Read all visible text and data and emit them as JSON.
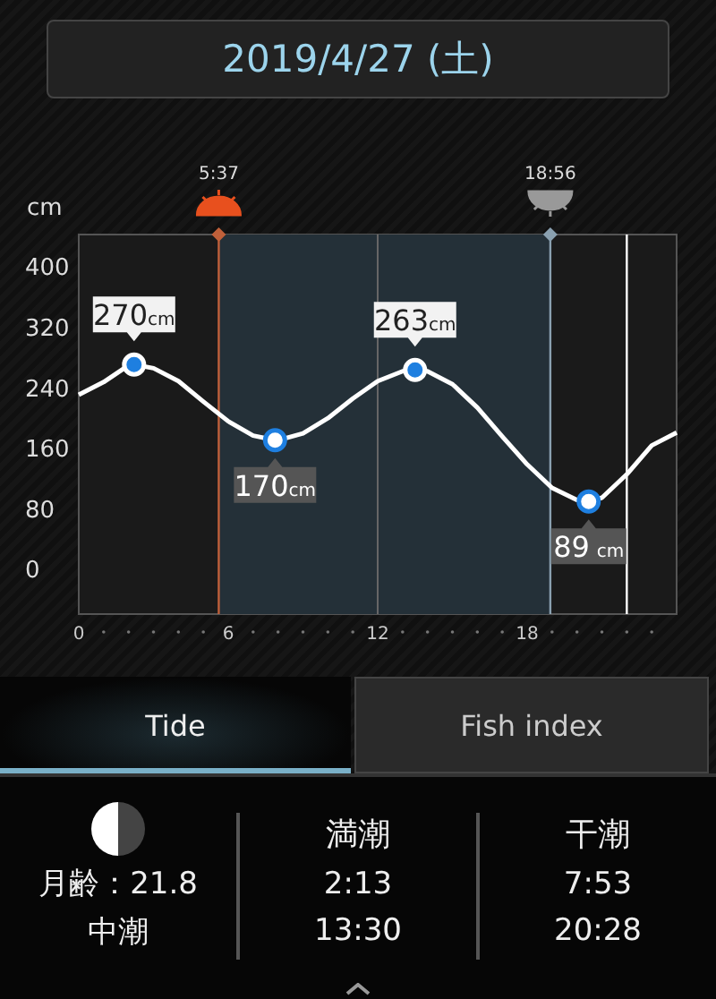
{
  "header": {
    "date": "2019/4/27 (土)"
  },
  "chart": {
    "chart_data": {
      "type": "line",
      "ylabel": "cm",
      "x": [
        0,
        1,
        2,
        2.22,
        3,
        4,
        5,
        6,
        7,
        7.88,
        8,
        9,
        10,
        11,
        12,
        13,
        13.5,
        14,
        15,
        16,
        17,
        18,
        19,
        20,
        20.47,
        21,
        22,
        23,
        24
      ],
      "series": [
        {
          "color": "#ffffff",
          "values": [
            230,
            247,
            269,
            270,
            265,
            248,
            221,
            195,
            176,
            170,
            170,
            179,
            199,
            225,
            248,
            261,
            263,
            261,
            244,
            213,
            175,
            138,
            107,
            91,
            89,
            94,
            125,
            163,
            180
          ]
        }
      ],
      "xlim": [
        0,
        24
      ],
      "ylim": [
        -60,
        442
      ],
      "xticks": [
        0,
        6,
        12,
        18
      ],
      "yticks": [
        0,
        80,
        160,
        240,
        320,
        400
      ],
      "ref_lines": [
        {
          "axis": "x",
          "value": 5.62,
          "color": "#c0603a"
        },
        {
          "axis": "x",
          "value": 18.93,
          "color": "#8aa0b0"
        },
        {
          "axis": "x",
          "value": 22,
          "color": "#ffffff"
        }
      ],
      "bands": [
        {
          "axis": "x",
          "from": 5.62,
          "to": 18.93,
          "color": "#243038"
        }
      ],
      "annotations": [
        {
          "x": 2.22,
          "y": 270,
          "text": "270cm"
        },
        {
          "x": 7.88,
          "y": 170,
          "text": "170cm"
        },
        {
          "x": 13.5,
          "y": 263,
          "text": "263cm"
        },
        {
          "x": 20.47,
          "y": 89,
          "text": "89 cm"
        }
      ]
    },
    "sun_times": [
      {
        "kind": "sunrise",
        "time": "5:37"
      },
      {
        "kind": "sunset",
        "time": "18:56"
      }
    ]
  },
  "tabs": [
    {
      "label": "Tide",
      "selected": true
    },
    {
      "label": "Fish index",
      "selected": false
    }
  ],
  "info": {
    "moon_age": "月齢：21.8",
    "tide_name": "中潮",
    "columns": [
      {
        "title": "満潮",
        "times": [
          "2:13",
          "13:30"
        ]
      },
      {
        "title": "干潮",
        "times": [
          "7:53",
          "20:28"
        ]
      }
    ]
  }
}
